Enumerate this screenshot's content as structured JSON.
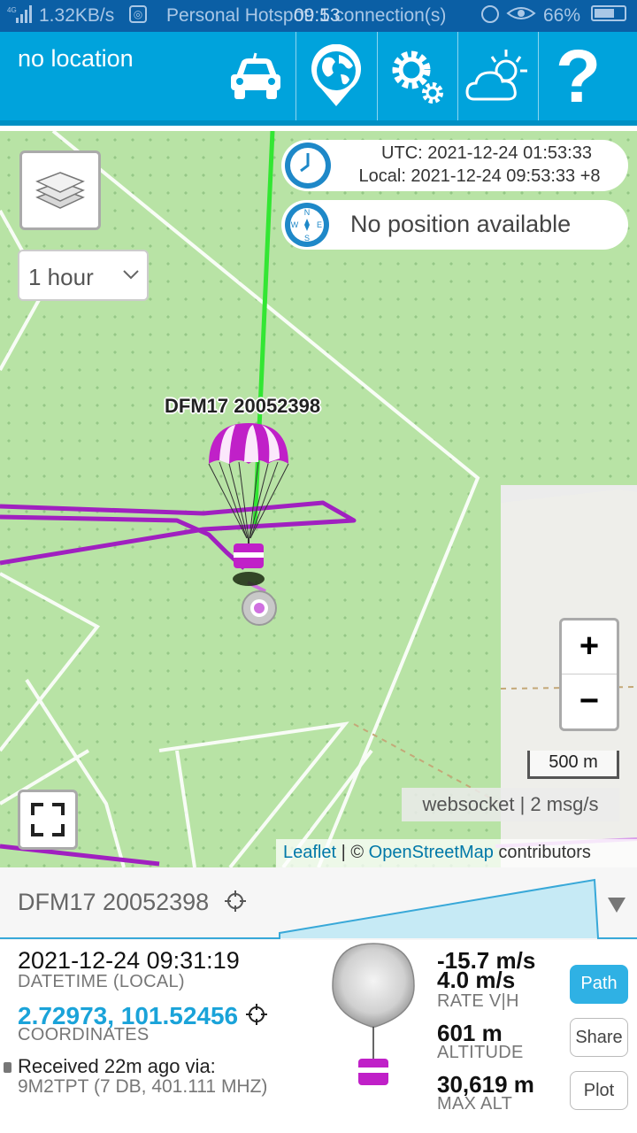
{
  "status_bar": {
    "network": "4G",
    "speed": "1.32KB/s",
    "hotspot": "Personal Hotspot: 1 connection(s)",
    "time": "09:53",
    "battery": "66%",
    "battery_level": 0.66
  },
  "header": {
    "location": "no location"
  },
  "map": {
    "time_select": "1 hour",
    "clock": {
      "utc": "UTC: 2021-12-24 01:53:33",
      "local": "Local: 2021-12-24 09:53:33 +8"
    },
    "position": "No position available",
    "marker_label": "DFM17 20052398",
    "zoom_in": "+",
    "zoom_out": "−",
    "scale": "500 m",
    "websocket_status": "websocket | 2 msg/s",
    "attribution": {
      "leaflet": "Leaflet",
      "sep": " | © ",
      "osm": "OpenStreetMap",
      "suffix": " contributors"
    }
  },
  "sonde": {
    "name": "DFM17 20052398",
    "datetime": "2021-12-24 09:31:19",
    "datetime_label": "DATETIME (LOCAL)",
    "coordinates": "2.72973, 101.52456",
    "coordinates_label": "COORDINATES",
    "received": "Received 22m ago via:",
    "receiver": "9M2TPT (7 DB, 401.111 MHZ)",
    "rate_v": "-15.7 m/s",
    "rate_h": "4.0 m/s",
    "rate_label": "RATE V|H",
    "altitude": "601 m",
    "altitude_label": "ALTITUDE",
    "max_alt": "30,619 m",
    "max_alt_label": "MAX ALT",
    "buttons": {
      "path": "Path",
      "share": "Share",
      "plot": "Plot"
    }
  },
  "colors": {
    "header": "#00a3dc",
    "status_bar": "#0b5fa5",
    "flight_path": "#a020c0",
    "ascent_path": "#33e633",
    "accent_blue": "#1aa3d9"
  }
}
